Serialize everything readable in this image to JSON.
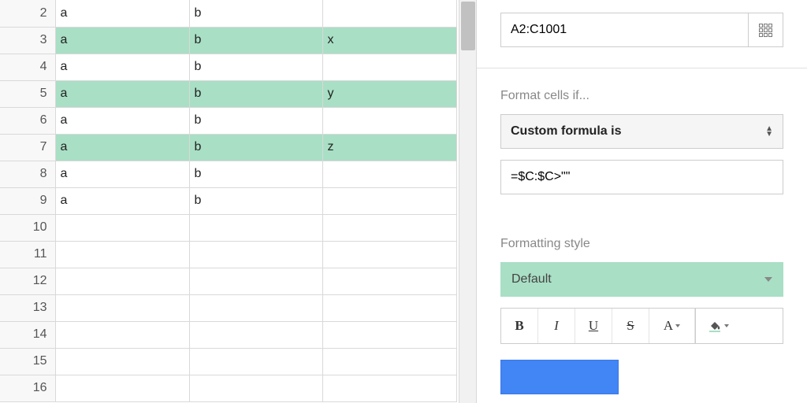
{
  "sheet": {
    "rows": [
      {
        "num": "2",
        "a": "a",
        "b": "b",
        "c": "",
        "hl": false
      },
      {
        "num": "3",
        "a": "a",
        "b": "b",
        "c": "x",
        "hl": true
      },
      {
        "num": "4",
        "a": "a",
        "b": "b",
        "c": "",
        "hl": false
      },
      {
        "num": "5",
        "a": "a",
        "b": "b",
        "c": "y",
        "hl": true
      },
      {
        "num": "6",
        "a": "a",
        "b": "b",
        "c": "",
        "hl": false
      },
      {
        "num": "7",
        "a": "a",
        "b": "b",
        "c": "z",
        "hl": true
      },
      {
        "num": "8",
        "a": "a",
        "b": "b",
        "c": "",
        "hl": false
      },
      {
        "num": "9",
        "a": "a",
        "b": "b",
        "c": "",
        "hl": false
      },
      {
        "num": "10",
        "a": "",
        "b": "",
        "c": "",
        "hl": false
      },
      {
        "num": "11",
        "a": "",
        "b": "",
        "c": "",
        "hl": false
      },
      {
        "num": "12",
        "a": "",
        "b": "",
        "c": "",
        "hl": false
      },
      {
        "num": "13",
        "a": "",
        "b": "",
        "c": "",
        "hl": false
      },
      {
        "num": "14",
        "a": "",
        "b": "",
        "c": "",
        "hl": false
      },
      {
        "num": "15",
        "a": "",
        "b": "",
        "c": "",
        "hl": false
      },
      {
        "num": "16",
        "a": "",
        "b": "",
        "c": "",
        "hl": false
      }
    ]
  },
  "panel": {
    "range_value": "A2:C1001",
    "format_if_label": "Format cells if...",
    "condition_selected": "Custom formula is",
    "formula_value": "=$C:$C>\"\"",
    "style_label": "Formatting style",
    "style_selected": "Default",
    "toolbar": {
      "bold": "B",
      "italic": "I",
      "underline": "U",
      "strike": "S",
      "textcolor": "A"
    }
  }
}
